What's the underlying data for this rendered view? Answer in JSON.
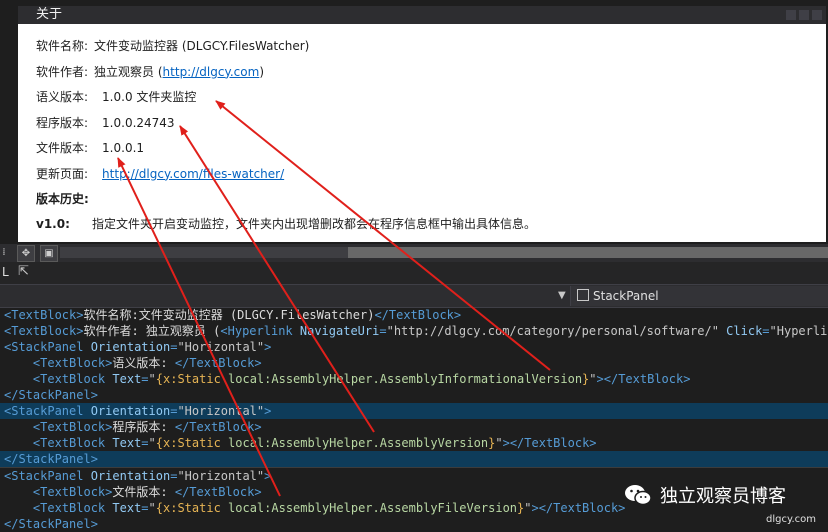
{
  "about": {
    "title": "关于",
    "software_name_label": "软件名称:",
    "software_name_value": "文件变动监控器 (DLGCY.FilesWatcher)",
    "author_label": "软件作者:",
    "author_value": "独立观察员 (",
    "author_link": "http://dlgcy.com",
    "author_close": ")",
    "semantic_version_label": "语义版本:",
    "semantic_version_value": "1.0.0 文件夹监控",
    "assembly_version_label": "程序版本:",
    "assembly_version_value": "1.0.0.24743",
    "file_version_label": "文件版本:",
    "file_version_value": "1.0.0.1",
    "update_page_label": "更新页面:",
    "update_page_link": "http://dlgcy.com/files-watcher/",
    "history_heading": "版本历史:",
    "history": [
      {
        "version": "v1.0:",
        "text": "指定文件夹开启变动监控，文件夹内出现增删改都会在程序信息框中输出具体信息。"
      }
    ]
  },
  "ide": {
    "left_letter": "L",
    "stackpanel_combo": "StackPanel",
    "code_lines": [
      [
        "<TextBlock>",
        "软件名称: 文件变动监控器 (DLGCY.FilesWatcher)",
        "</TextBlock>"
      ],
      [
        "<TextBlock>",
        "软件作者: 独立观察员 (",
        "<Hyperlink NavigateUri=\"http://dlgcy.com/category/personal/software/\" Click=\"Hyperlin"
      ],
      [
        "<StackPanel Orientation=\"Horizontal\">"
      ],
      [
        "    <TextBlock>",
        "语义版本: ",
        "</TextBlock>"
      ],
      [
        "    <TextBlock Text=\"{x:Static local:AssemblyHelper.AssemblyInformationalVersion}\"></TextBlock>"
      ],
      [
        "</StackPanel>"
      ],
      [
        "<StackPanel Orientation=\"Horizontal\">"
      ],
      [
        "    <TextBlock>",
        "程序版本: ",
        "</TextBlock>"
      ],
      [
        "    <TextBlock Text=\"{x:Static local:AssemblyHelper.AssemblyVersion}\"></TextBlock>"
      ],
      [
        "</StackPanel>"
      ],
      [
        "<StackPanel Orientation=\"Horizontal\">"
      ],
      [
        "    <TextBlock>",
        "文件版本: ",
        "</TextBlock>"
      ],
      [
        "    <TextBlock Text=\"{x:Static local:AssemblyHelper.AssemblyFileVersion}\"></TextBlock>"
      ],
      [
        "</StackPanel>"
      ]
    ]
  },
  "watermark": {
    "name": "独立观察员博客",
    "url": "dlgcy.com"
  },
  "colors": {
    "arrow": "#e0201b",
    "link": "#0563c1",
    "xml_tag": "#569cd6",
    "xml_attr": "#92caf4",
    "markup_ext": "#e6b454"
  }
}
